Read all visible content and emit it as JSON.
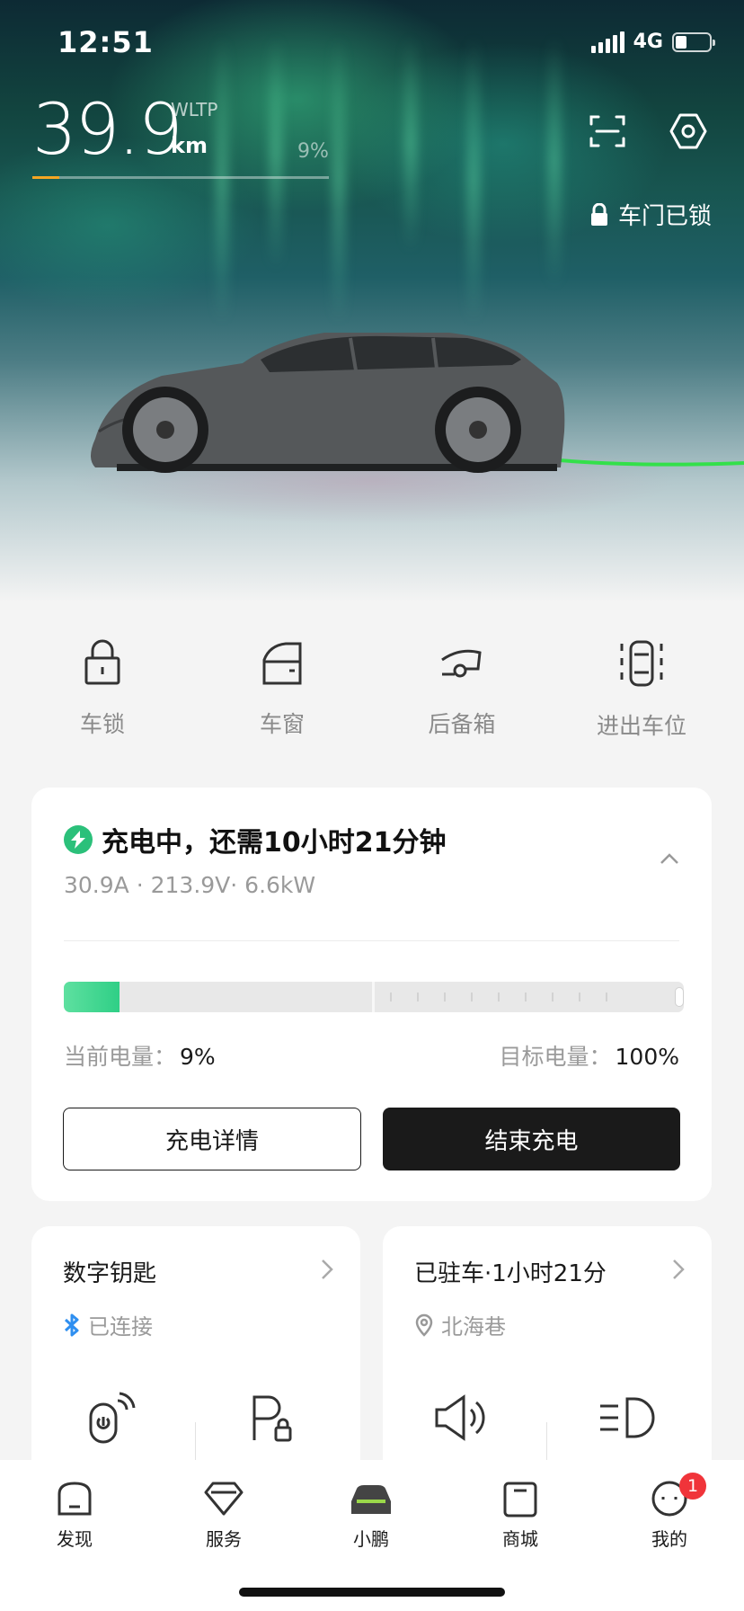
{
  "status_bar": {
    "time": "12:51",
    "network": "4G",
    "battery_percent": 30
  },
  "hero": {
    "range_value": "39.9",
    "range_standard": "WLTP",
    "range_unit": "km",
    "battery_percent_label": "9%",
    "battery_level": 0.09,
    "lock_status": "车门已锁",
    "icons": [
      "scan-icon",
      "settings-hex-icon"
    ]
  },
  "quick_actions": [
    {
      "label": "车锁",
      "icon": "lock-icon"
    },
    {
      "label": "车窗",
      "icon": "window-icon"
    },
    {
      "label": "后备箱",
      "icon": "trunk-icon"
    },
    {
      "label": "进出车位",
      "icon": "parking-in-out-icon"
    }
  ],
  "charging": {
    "title": "充电中，还需10小时21分钟",
    "details": "30.9A · 213.9V· 6.6kW",
    "current_soc_label": "当前电量：",
    "current_soc": "9%",
    "current_soc_level": 0.09,
    "target_soc_label": "目标电量：",
    "target_soc": "100%",
    "details_button": "充电详情",
    "stop_button": "结束充电",
    "accent_color": "#2bc07a"
  },
  "digital_key": {
    "title": "数字钥匙",
    "status": "已连接",
    "actions": [
      "remote-start-icon",
      "parking-lock-icon"
    ]
  },
  "parked": {
    "title": "已驻车·1小时21分",
    "location": "北海巷",
    "actions": [
      "horn-icon",
      "headlight-icon"
    ]
  },
  "tabbar": {
    "items": [
      {
        "label": "发现",
        "icon": "discover-icon"
      },
      {
        "label": "服务",
        "icon": "service-icon"
      },
      {
        "label": "小鹏",
        "icon": "car-icon",
        "active": true
      },
      {
        "label": "商城",
        "icon": "shop-icon"
      },
      {
        "label": "我的",
        "icon": "profile-icon",
        "badge": "1"
      }
    ]
  }
}
